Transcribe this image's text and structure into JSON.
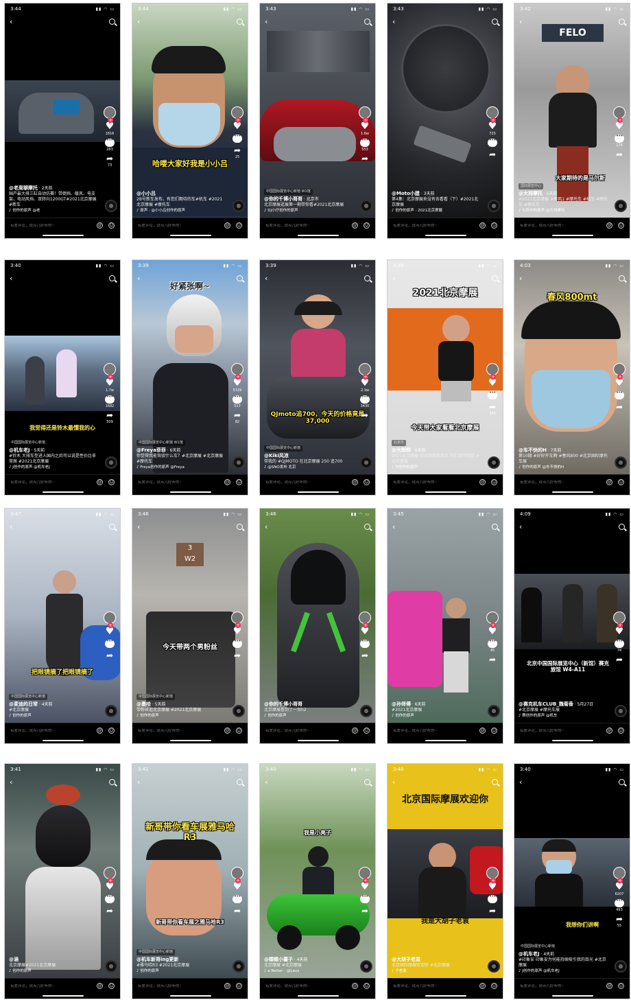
{
  "comment_placeholder": "有爱评论，说点儿好听的~",
  "icons": {
    "back": "chevron-left-icon",
    "search": "search-icon",
    "like": "heart-icon",
    "comment": "comment-icon",
    "share": "share-icon",
    "at": "at-icon",
    "emoji": "emoji-icon",
    "music": "music-note-icon"
  },
  "colors": {
    "like_red": "#fe2c55",
    "overlay_yellow": "#ffe94a"
  },
  "phones": [
    {
      "time": "3:44",
      "overlay": "",
      "author": "@老周聊摩托",
      "meta": "· 2天前",
      "loc": "",
      "desc": "国产最大排三缸自动仿赛！带倒挡、暖风、电支架、电动风挡、双转向1200GT#2021北京摩展 #新车",
      "music": "♪ 创作的原声  @老",
      "likes": "1816",
      "comments": "283",
      "shares": "73"
    },
    {
      "time": "3:44",
      "overlay": "哈喽大家好我是小小吕",
      "author": "@小小吕",
      "meta": "",
      "loc": "",
      "desc": "2B号新车发布，有您们期待的车#机车 #2021北京摩展 #摩托车",
      "music": "♪ 原声 · @小小吕创作的原声",
      "likes": "",
      "comments": "",
      "shares": "25"
    },
    {
      "time": "3:43",
      "overlay": "",
      "author": "@你的千博小哥哥",
      "meta": "· 北京市",
      "loc": "中国国际展览中心新馆 W1馆",
      "desc": "北京摩展逛展第一期带你看#2021北京摩展",
      "music": "♪ DJ小仔创作的原声",
      "likes": "1.6w",
      "comments": "553",
      "shares": ""
    },
    {
      "time": "3:43",
      "overlay": "",
      "author": "@Moto小建",
      "meta": "· 3天前",
      "loc": "",
      "desc": "第4集：北京摩展来没有去看看（下）#2021北京摩展",
      "music": "♪ 创作的原声 · 2021北京摩展",
      "likes": "725",
      "comments": "",
      "shares": ""
    },
    {
      "time": "3:42",
      "overlay": "大家期待的是马尔斯",
      "author": "@大排摩托",
      "meta": "· 5天前",
      "loc": "国际展览中心",
      "desc": "#2021北京摩展 #春风1 #摩托车 #机车 #摩托车 #摩托车",
      "music": "♪ 七剑作的原声 @大排摩托",
      "likes": "",
      "comments": "176",
      "shares": ""
    },
    {
      "time": "3:40",
      "overlay": "我觉得还是铃木最懂我的心",
      "author": "@机车老J",
      "meta": "· 5天前",
      "loc": "中国国际展览中心新馆",
      "desc": "#铃木 大排车型进入国内之后可以说是性价比非常高 #2021北京摩展",
      "music": "♪ J创作的原声  @机车老J",
      "likes": "1.7w",
      "comments": "1682",
      "shares": "509"
    },
    {
      "time": "3:39",
      "overlay": "好紧张啊~",
      "author": "@Freya菲菲",
      "meta": "· 6天前",
      "loc": "中国国际展览中心新馆 W1馆",
      "desc": "你觉得我能驾驭什么车？#北京摩展 #北京摩展 #摩托车",
      "music": "♪ Freya创作的原声  @Freya",
      "likes": "5729",
      "comments": "517",
      "shares": "82"
    },
    {
      "time": "3:39",
      "overlay": "QJmoto追700，今天的价格竟是37,000",
      "author": "@Kiki风凉",
      "meta": "",
      "loc": "中国国际展览中心新馆",
      "desc": "带我的 #QJMOTO 在北京摩展 250 追700",
      "music": "♪ @SNO发布  北京",
      "likes": "2.3w",
      "comments": "3430",
      "shares": ""
    },
    {
      "time": "3:39",
      "overlay": "2021北京摩展",
      "overlay2": "今天带大家看看北京摩展",
      "author": "@大辉辉",
      "meta": "· 6天前",
      "loc": "北京市",
      "desc": "2021北京摩展 带大家看看新车 你们喜欢哪款 #北京摩展",
      "music": "♪ 作创作的原声",
      "likes": "",
      "comments": "",
      "shares": "340"
    },
    {
      "time": "4:03",
      "overlay": "春风800mt",
      "author": "@车不快的H",
      "meta": "· 7天前",
      "loc": "",
      "desc": "第10期 #好好开车啊 #春风800 #北京国际摩托车展",
      "music": "♪ 创作的原声  @车不快的H",
      "likes": "",
      "comments": "",
      "shares": ""
    },
    {
      "time": "3:47",
      "overlay": "把眼镜摘了把眼镜摘了",
      "author": "@麦迪的日常",
      "meta": "· 4天前",
      "loc": "中国国际展览中心新馆",
      "desc": "#北京摩展",
      "music": "♪ 创作的原声",
      "likes": "",
      "comments": "",
      "shares": ""
    },
    {
      "time": "3:46",
      "overlay": "今天带两个男粉丝",
      "author": "@墨哈",
      "meta": "· 5天前",
      "loc": "中国国际展览中心新馆",
      "desc": "带粉丝逛北京摩展 #2021北京摩展",
      "music": "♪ 创作的原声",
      "likes": "",
      "comments": "",
      "shares": ""
    },
    {
      "time": "3:46",
      "overlay": "",
      "author": "@你的千博小哥哥",
      "meta": "",
      "loc": "",
      "desc": "北京摩展看到了一台h2",
      "music": "♪ 创作的原声",
      "likes": "",
      "comments": "",
      "shares": ""
    },
    {
      "time": "3:45",
      "overlay": "",
      "author": "@孙师傅",
      "meta": "· 6天前",
      "loc": "",
      "desc": "#2021北京摩展",
      "music": "♪ 创作的原声",
      "likes": "",
      "comments": "45",
      "shares": ""
    },
    {
      "time": "4:09",
      "overlay": "北京中国国际展览中心（新馆）赛克旅馆 W4-A11",
      "author": "@赛克机车CLUB_魏菊香",
      "meta": "· 5月27日",
      "loc": "",
      "desc": "#北京摩展 #摩托车展",
      "music": "♪ 赛创作的原声  @机车",
      "likes": "",
      "comments": "74",
      "shares": ""
    },
    {
      "time": "3:41",
      "overlay": "",
      "author": "@涵",
      "meta": "",
      "loc": "",
      "desc": "北京摩展#2021北京摩展",
      "music": "♪ 创作的原声",
      "likes": "",
      "comments": "",
      "shares": ""
    },
    {
      "time": "3:41",
      "overlay": "新哥带你看车展雅马哈R3",
      "overlay2": "新哥带你看车展之雅马哈R3",
      "author": "@机车新哥ing更新",
      "meta": "",
      "loc": "中国国际展览中心新馆",
      "desc": "#雅马哈R3 #2021北京摩展",
      "music": "♪ 创作的原声",
      "likes": "",
      "comments": "",
      "shares": ""
    },
    {
      "time": "3:40",
      "overlay": "我是小亮子",
      "author": "@蝶蝶小蕾子",
      "meta": "· 4天前",
      "loc": "",
      "desc": "北京摩展 #北京摩展",
      "music": "♪ a Better - @Laus",
      "likes": "",
      "comments": "",
      "shares": ""
    },
    {
      "time": "3:40",
      "overlay": "北京国际摩展欢迎你",
      "overlay2": "我是大胡子老袁",
      "author": "@大胡子老袁",
      "meta": "",
      "loc": "",
      "desc": "北京国际摩展欢迎你 #北京摩展",
      "music": "♪ 子老袁",
      "likes": "",
      "comments": "",
      "shares": ""
    },
    {
      "time": "3:40",
      "overlay": "我想你们讲啊",
      "author": "@机车老J",
      "meta": "· 4天前",
      "loc": "中国国际展览中心新馆",
      "desc": "#印象安 印象安为何能持续吸引我的目光 #北京摩展",
      "music": "♪ J创作的原声  @机车老J",
      "likes": "6207",
      "comments": "493",
      "shares": "55"
    }
  ]
}
